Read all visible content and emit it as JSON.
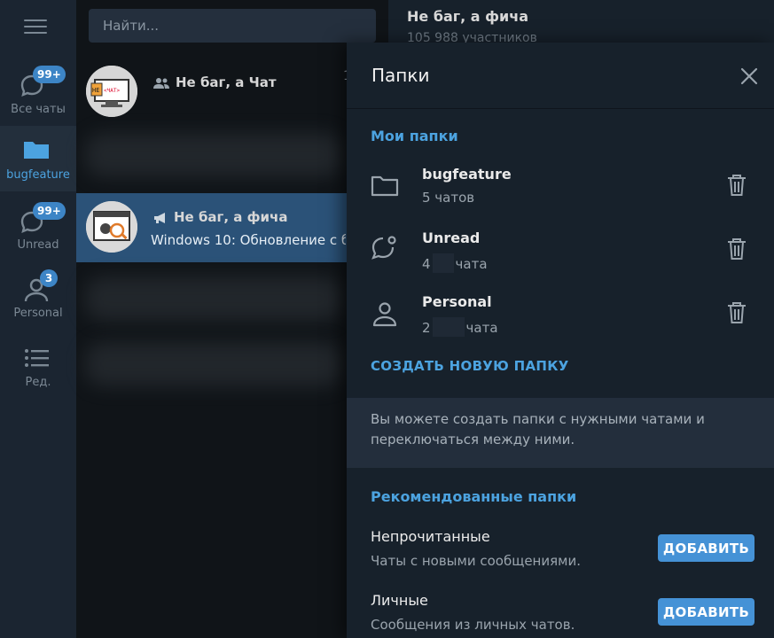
{
  "search": {
    "placeholder": "Найти..."
  },
  "rail": {
    "items": [
      {
        "label": "Все чаты",
        "badge": "99+",
        "icon": "chat-bubbles-icon"
      },
      {
        "label": "bugfeature",
        "badge": "",
        "icon": "folder-icon"
      },
      {
        "label": "Unread",
        "badge": "99+",
        "icon": "unread-bubble-icon"
      },
      {
        "label": "Personal",
        "badge": "3",
        "icon": "person-icon"
      },
      {
        "label": "Ред.",
        "badge": "",
        "icon": "edit-list-icon"
      }
    ]
  },
  "chats": [
    {
      "title": "Не баг, а Чат",
      "subtitle": "",
      "type": "group",
      "time": "1"
    },
    {
      "title": "Не баг, а фича",
      "subtitle": "Windows 10: Обновление с б",
      "type": "channel"
    }
  ],
  "conversation": {
    "title": "Не баг, а фича",
    "subtitle": "105 988 участников"
  },
  "panel": {
    "title": "Папки",
    "my_folders_heading": "Мои папки",
    "folders": [
      {
        "name": "bugfeature",
        "count_prefix": "5 чатов",
        "count_suffix": "",
        "icon": "folder-icon"
      },
      {
        "name": "Unread",
        "count_prefix": "4",
        "count_suffix": "чата",
        "icon": "unread-bubble-icon"
      },
      {
        "name": "Personal",
        "count_prefix": "2",
        "count_suffix": "чата",
        "icon": "person-icon"
      }
    ],
    "create_label": "СОЗДАТЬ НОВУЮ ПАПКУ",
    "info_text": "Вы можете создать папки с нужными чатами и переключаться между ними.",
    "recommended_heading": "Рекомендованные папки",
    "recommended": [
      {
        "name": "Непрочитанные",
        "description": "Чаты с новыми сообщениями.",
        "button": "ДОБАВИТЬ"
      },
      {
        "name": "Личные",
        "description": "Сообщения из личных чатов.",
        "button": "ДОБАВИТЬ"
      }
    ]
  },
  "colors": {
    "accent": "#4ca3e0",
    "selected_row": "#2b5278",
    "button": "#4592d6"
  }
}
